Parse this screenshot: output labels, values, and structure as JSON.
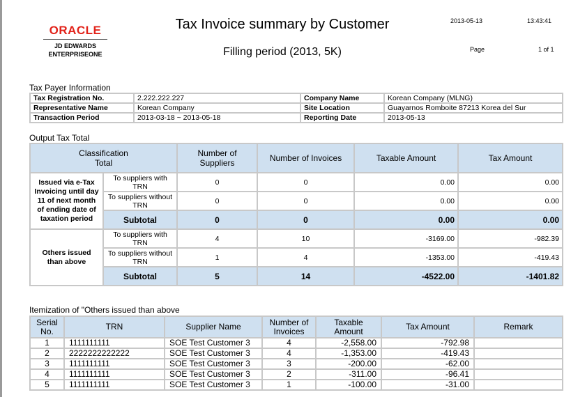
{
  "header": {
    "logo_brand": "ORACLE",
    "logo_line1": "JD EDWARDS",
    "logo_line2": "ENTERPRISEONE",
    "title": "Tax Invoice summary by Customer",
    "subtitle": "Filling period (2013, 5K)",
    "date": "2013-05-13",
    "time": "13:43:41",
    "page_label": "Page",
    "page_value": "1 of 1"
  },
  "taxpayer": {
    "section_title": "Tax Payer Information",
    "rows": [
      {
        "l1": "Tax Registration No.",
        "v1": "2.222.222.227",
        "l2": "Company Name",
        "v2": "Korean Company (MLNG)"
      },
      {
        "l1": "Representative Name",
        "v1": "Korean Company",
        "l2": "Site Location",
        "v2": "Guayarnos Romboite 87213 Korea del Sur"
      },
      {
        "l1": "Transaction Period",
        "v1": "2013-03-18 ~ 2013-05-18",
        "l2": "Reporting Date",
        "v2": "2013-05-13"
      }
    ]
  },
  "output": {
    "section_title": "Output Tax Total",
    "headers": {
      "class1": "Classification",
      "class2": "Total",
      "suppliers": "Number of Suppliers",
      "invoices": "Number of Invoices",
      "taxable": "Taxable Amount",
      "tax": "Tax Amount"
    },
    "groups": [
      {
        "label": "Issued via e-Tax Invoicing until day 11 of next month of ending date of taxation period",
        "rows": [
          {
            "type": "To suppliers with TRN",
            "suppliers": "0",
            "invoices": "0",
            "taxable": "0.00",
            "tax": "0.00"
          },
          {
            "type": "To suppliers without TRN",
            "suppliers": "0",
            "invoices": "0",
            "taxable": "0.00",
            "tax": "0.00"
          }
        ],
        "subtotal": {
          "label": "Subtotal",
          "suppliers": "0",
          "invoices": "0",
          "taxable": "0.00",
          "tax": "0.00"
        }
      },
      {
        "label": "Others issued than above",
        "rows": [
          {
            "type": "To suppliers with TRN",
            "suppliers": "4",
            "invoices": "10",
            "taxable": "-3169.00",
            "tax": "-982.39"
          },
          {
            "type": "To suppliers without TRN",
            "suppliers": "1",
            "invoices": "4",
            "taxable": "-1353.00",
            "tax": "-419.43"
          }
        ],
        "subtotal": {
          "label": "Subtotal",
          "suppliers": "5",
          "invoices": "14",
          "taxable": "-4522.00",
          "tax": "-1401.82"
        }
      }
    ]
  },
  "itemization": {
    "section_title": "Itemization of \"Others issued than above",
    "headers": [
      "Serial No.",
      "TRN",
      "Supplier Name",
      "Number of Invoices",
      "Taxable Amount",
      "Tax Amount",
      "Remark"
    ],
    "rows": [
      [
        "1",
        "1111111111",
        "SOE Test Customer 3",
        "4",
        "-2,558.00",
        "-792.98",
        ""
      ],
      [
        "2",
        "2222222222222",
        "SOE Test Customer 3",
        "4",
        "-1,353.00",
        "-419.43",
        ""
      ],
      [
        "3",
        "1111111111",
        "SOE Test Customer 3",
        "3",
        "-200.00",
        "-62.00",
        ""
      ],
      [
        "4",
        "1111111111",
        "SOE Test Customer 3",
        "2",
        "-311.00",
        "-96.41",
        ""
      ],
      [
        "5",
        "1111111111",
        "SOE Test Customer 3",
        "1",
        "-100.00",
        "-31.00",
        ""
      ]
    ]
  }
}
